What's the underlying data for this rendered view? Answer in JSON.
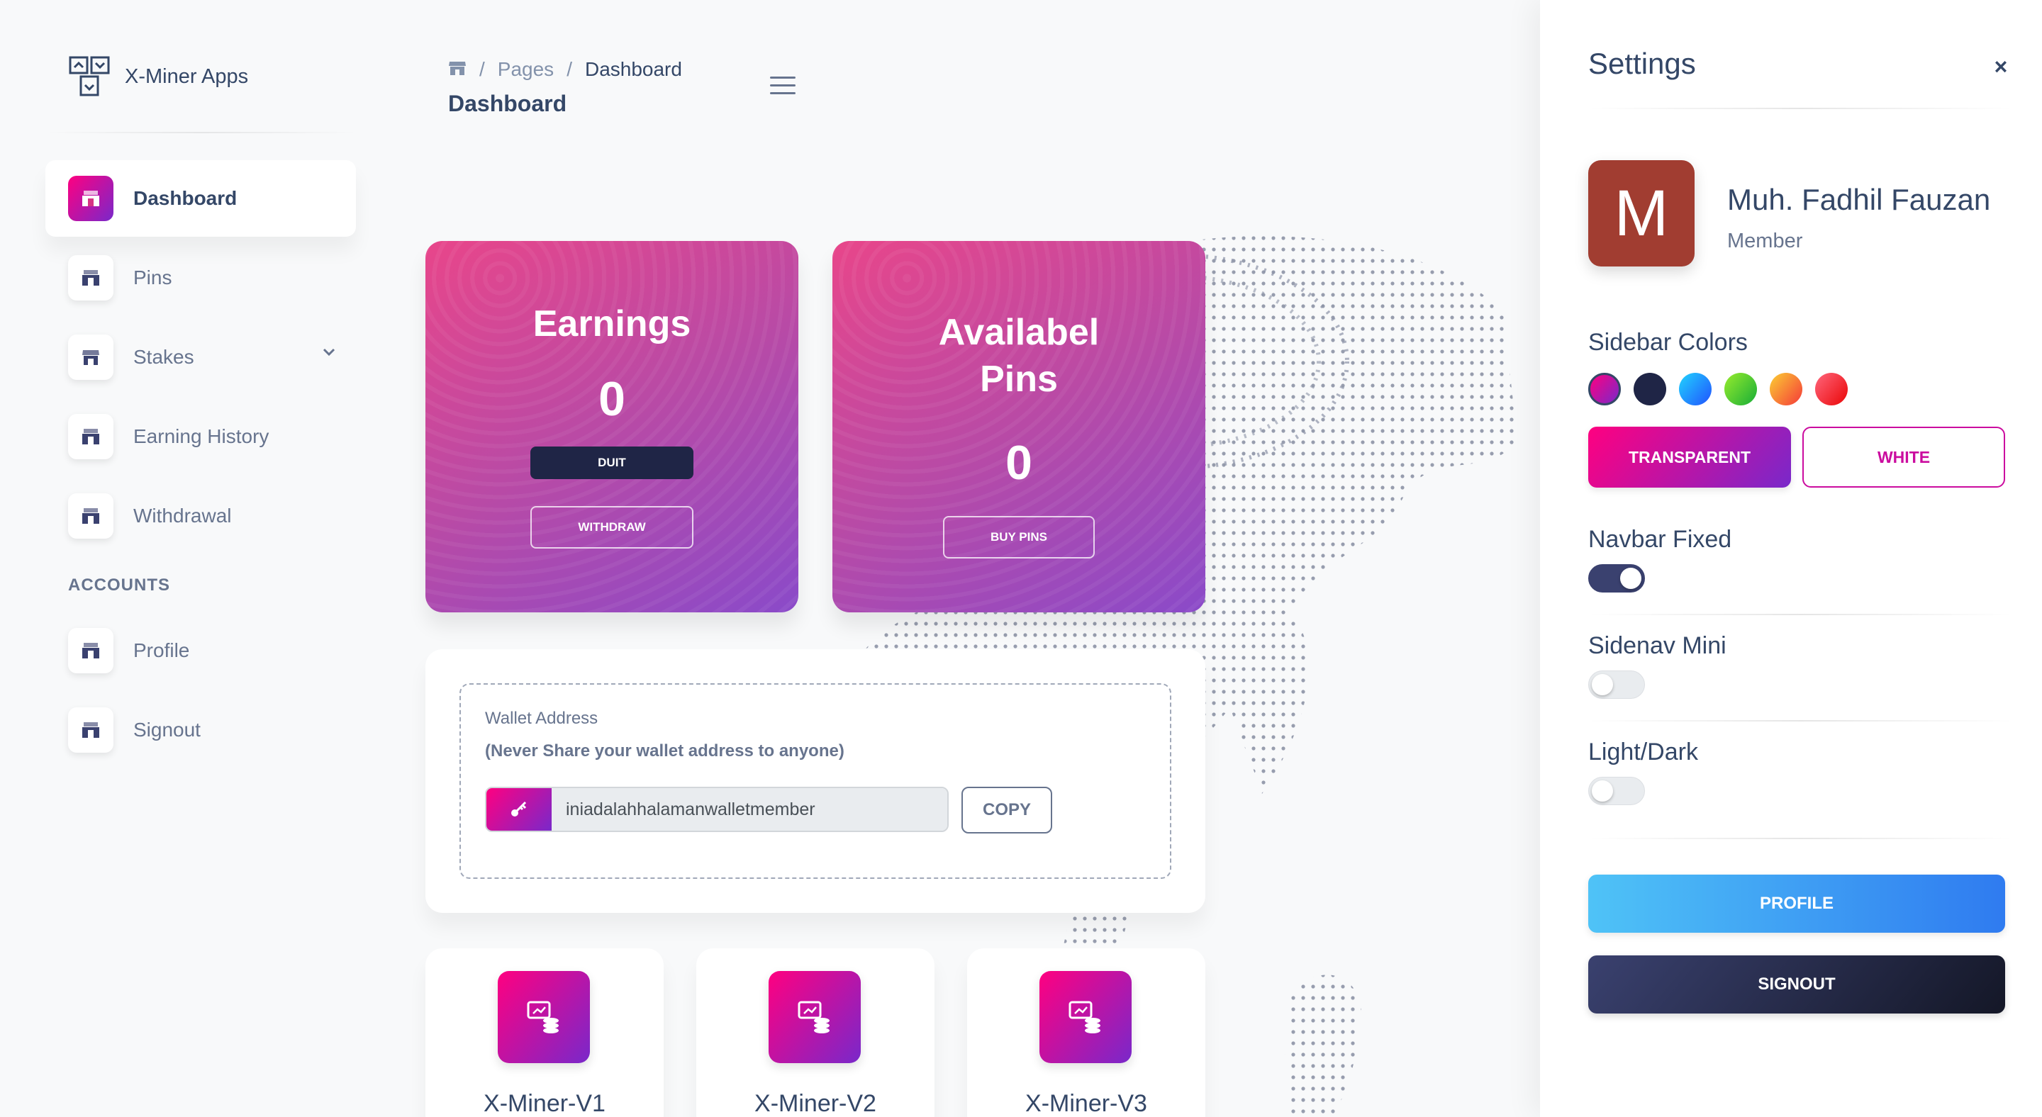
{
  "brand": {
    "name": "X-Miner Apps",
    "icon": "x-miner-logo"
  },
  "sidebar": {
    "items": [
      {
        "label": "Dashboard",
        "icon": "shop-icon",
        "active": true
      },
      {
        "label": "Pins",
        "icon": "shop-icon"
      },
      {
        "label": "Stakes",
        "icon": "store-icon",
        "has_submenu": true
      },
      {
        "label": "Earning History",
        "icon": "shop-icon"
      },
      {
        "label": "Withdrawal",
        "icon": "shop-icon"
      }
    ],
    "section_label": "ACCOUNTS",
    "account_items": [
      {
        "label": "Profile",
        "icon": "shop-icon"
      },
      {
        "label": "Signout",
        "icon": "shop-icon"
      }
    ]
  },
  "header": {
    "breadcrumb": {
      "home_icon": "home-icon",
      "separator": "/",
      "parent": "Pages",
      "current": "Dashboard"
    },
    "title": "Dashboard",
    "menu_icon": "hamburger-icon"
  },
  "cards": {
    "earnings": {
      "title": "Earnings",
      "value": "0",
      "badge": "DUIT",
      "button": "WITHDRAW"
    },
    "pins": {
      "title_line1": "Availabel",
      "title_line2": "Pins",
      "value": "0",
      "button": "BUY PINS"
    }
  },
  "wallet": {
    "label": "Wallet Address",
    "warning": "(Never Share your wallet address to anyone)",
    "key_icon": "key-icon",
    "value": "iniadalahhalamanwalletmember",
    "copy_label": "COPY"
  },
  "miners": [
    {
      "title": "X-Miner-V1",
      "icon": "coins-screen-icon"
    },
    {
      "title": "X-Miner-V2",
      "icon": "coins-screen-icon"
    },
    {
      "title": "X-Miner-V3",
      "icon": "coins-screen-icon"
    }
  ],
  "settings": {
    "title": "Settings",
    "close_label": "×",
    "user": {
      "initial": "M",
      "name": "Muh. Fadhil Fauzan",
      "role": "Member"
    },
    "sidebar_colors_label": "Sidebar Colors",
    "colors": [
      "#cb0c9f",
      "#1f2546",
      "#2f8cf0",
      "#6ccf3e",
      "#f5a03a",
      "#ea3a2a"
    ],
    "transparent_label": "TRANSPARENT",
    "white_label": "WHITE",
    "navbar_fixed_label": "Navbar Fixed",
    "navbar_fixed": true,
    "sidenav_mini_label": "Sidenav Mini",
    "sidenav_mini": false,
    "light_dark_label": "Light/Dark",
    "light_dark": false,
    "profile_button": "PROFILE",
    "signout_button": "SIGNOUT"
  }
}
